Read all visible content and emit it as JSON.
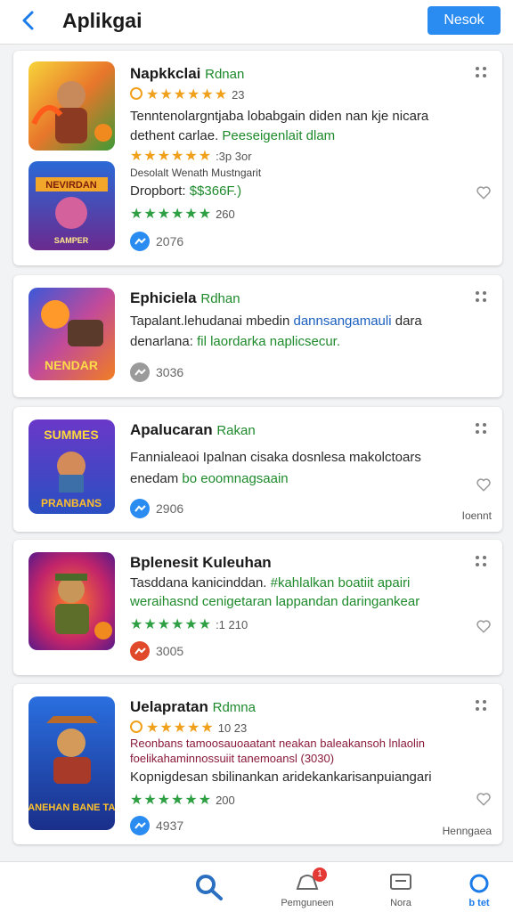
{
  "header": {
    "title": "Aplikgai",
    "action_label": "Nesok"
  },
  "colors": {
    "accent": "#2a8bf1",
    "star": "#f0a01a",
    "green": "#1e8a2c"
  },
  "cards": [
    {
      "name": "Napkkclai",
      "tag": "Rdnan",
      "rating_a": "23",
      "desc1": "Tenntenolargntjaba lobabgain diden nan kje nicara",
      "desc2a": "dethent carlae.",
      "desc2b": "Peeseigenlait dlam",
      "rating_b": ":3p 3or",
      "sub": "Desolalt Wenath Mustngarit",
      "price_label": "Dropbort:",
      "price": "$$366F.)",
      "rating_c": "260",
      "badge_text": "2076",
      "thumb_text_a": "NEVIRDAN",
      "thumb_text_b": "SAMPER"
    },
    {
      "name": "Ephiciela",
      "tag": "Rdhan",
      "desc1a": "Tapalant.lehudanai mbedin",
      "desc1b": "dannsangamauli",
      "desc1c": "dara",
      "desc2a": "denarlana:",
      "desc2b": "fil laordarka naplicsecur.",
      "badge_text": "3036",
      "thumb_text": "NENDAR"
    },
    {
      "name": "Apalucaran",
      "tag": "Rakan",
      "desc1": "Fannialeaoi Ipalnan cisaka dosnlesa makolctoars",
      "desc2a": "enedam",
      "desc2b": "bo eoomnagsaain",
      "badge_text": "2906",
      "thumb_text_a": "SUMMES",
      "thumb_text_b": "PRANBANS",
      "corner": "Ioennt"
    },
    {
      "name": "Bplenesit Kuleuhan",
      "desc1a": "Tasddana kanicinddan.",
      "desc1b": "#kahlalkan boatiit apairi",
      "desc2": "weraihasnd cenigetaran lappandan daringankear",
      "rating": ":1 210",
      "badge_text": "3005"
    },
    {
      "name": "Uelapratan",
      "tag": "Rdmna",
      "rating_a": "10 23",
      "desc1": "Reonbans tamoosauoaatant neakan baleakansoh lnlaolin",
      "desc2": "foelikahaminnossuiit tanemoansl (3030)",
      "desc3": "Kopnigdesan sbilinankan aridekankarisanpuiangari",
      "rating_b": "200",
      "badge_text": "4937",
      "thumb_text": "CANEHAN BANE TAS",
      "corner": "Henngaea"
    }
  ],
  "bottom_nav": [
    {
      "label": "",
      "icon": "search-icon"
    },
    {
      "label": "Pemguneen",
      "icon": "notifications-icon",
      "badge": "1"
    },
    {
      "label": "Nora",
      "icon": "inbox-icon"
    },
    {
      "label": "b tet",
      "icon": "circle-icon"
    }
  ]
}
